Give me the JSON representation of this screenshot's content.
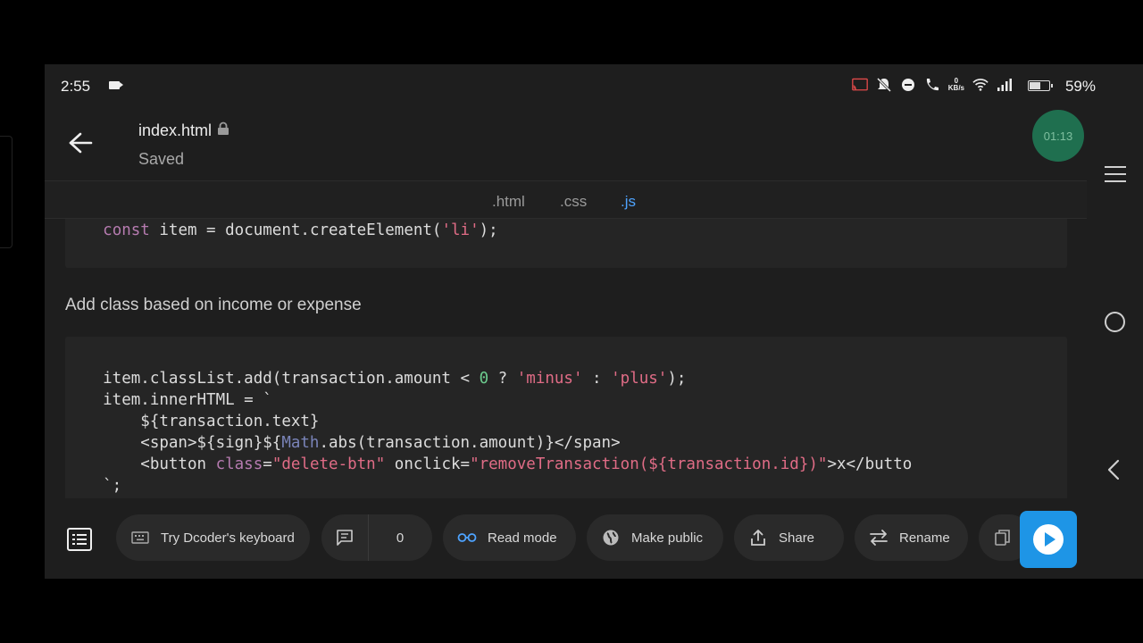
{
  "status_bar": {
    "time": "2:55",
    "network_speed_value": "0",
    "network_speed_unit": "KB/s",
    "battery": "59%"
  },
  "header": {
    "filename": "index.html",
    "status": "Saved",
    "timer": "01:13"
  },
  "tabs": [
    {
      "label": ".html",
      "active": false
    },
    {
      "label": ".css",
      "active": false
    },
    {
      "label": ".js",
      "active": true
    }
  ],
  "content": {
    "code_block_1": [
      "    const item = document.createElement('li');"
    ],
    "description": "Add class based on income or expense",
    "code_block_2": [
      "    item.classList.add(transaction.amount < 0 ? 'minus' : 'plus');",
      "    item.innerHTML = `",
      "        ${transaction.text}",
      "        <span>${sign}${Math.abs(transaction.amount)}</span>",
      "        <button class=\"delete-btn\" onclick=\"removeTransaction(${transaction.id})\">x</butto",
      "    `;"
    ]
  },
  "toolbar": {
    "keyboard_label": "Try Dcoder's keyboard",
    "comments_count": "0",
    "read_mode_label": "Read mode",
    "make_public_label": "Make public",
    "share_label": "Share",
    "rename_label": "Rename"
  },
  "colors": {
    "accent": "#1e95e6",
    "tab_active": "#4ea3ff",
    "timer_bg": "#1f6f4f"
  }
}
